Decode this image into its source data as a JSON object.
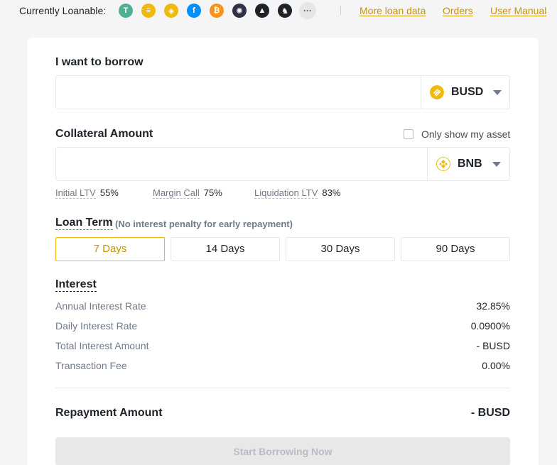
{
  "topbar": {
    "loanable_label": "Currently Loanable:",
    "coins": [
      {
        "icon": "usdt-icon",
        "glyph": "T",
        "color": "#50af95"
      },
      {
        "icon": "busd-icon",
        "glyph": "≡",
        "color": "#f0b90b"
      },
      {
        "icon": "bnb-icon",
        "glyph": "◈",
        "color": "#f0b90b"
      },
      {
        "icon": "filecoin-icon",
        "glyph": "f",
        "color": "#0090ff"
      },
      {
        "icon": "bitcoin-icon",
        "glyph": "₿",
        "color": "#f7931a"
      },
      {
        "icon": "cosmos-icon",
        "glyph": "✺",
        "color": "#2e3148"
      },
      {
        "icon": "mountain-icon",
        "glyph": "▲",
        "color": "#1e2329"
      },
      {
        "icon": "horse-icon",
        "glyph": "♞",
        "color": "#1e2329"
      }
    ],
    "more_glyph": "···",
    "links": {
      "more_loan_data": "More loan data",
      "orders": "Orders",
      "user_manual": "User Manual"
    }
  },
  "borrow": {
    "label": "I want to borrow",
    "value": "",
    "asset": "BUSD"
  },
  "collateral": {
    "label": "Collateral Amount",
    "only_show_label": "Only show my asset",
    "value": "",
    "asset": "BNB"
  },
  "ltv": {
    "initial_label": "Initial LTV",
    "initial_value": "55%",
    "margin_label": "Margin Call",
    "margin_value": "75%",
    "liquidation_label": "Liquidation LTV",
    "liquidation_value": "83%"
  },
  "loan_term": {
    "title": "Loan Term",
    "note": "(No interest penalty for early repayment)",
    "options": [
      "7 Days",
      "14 Days",
      "30 Days",
      "90 Days"
    ],
    "selected": "7 Days"
  },
  "interest": {
    "title": "Interest",
    "rows": [
      {
        "label": "Annual Interest Rate",
        "value": "32.85%"
      },
      {
        "label": "Daily Interest Rate",
        "value": "0.0900%"
      },
      {
        "label": "Total Interest Amount",
        "value": "- BUSD"
      },
      {
        "label": "Transaction Fee",
        "value": "0.00%"
      }
    ]
  },
  "repayment": {
    "label": "Repayment Amount",
    "value": "- BUSD"
  },
  "start_button": "Start Borrowing Now",
  "colors": {
    "accent": "#f0b90b",
    "link": "#c99400",
    "text": "#1e2329",
    "muted": "#707a8a"
  }
}
